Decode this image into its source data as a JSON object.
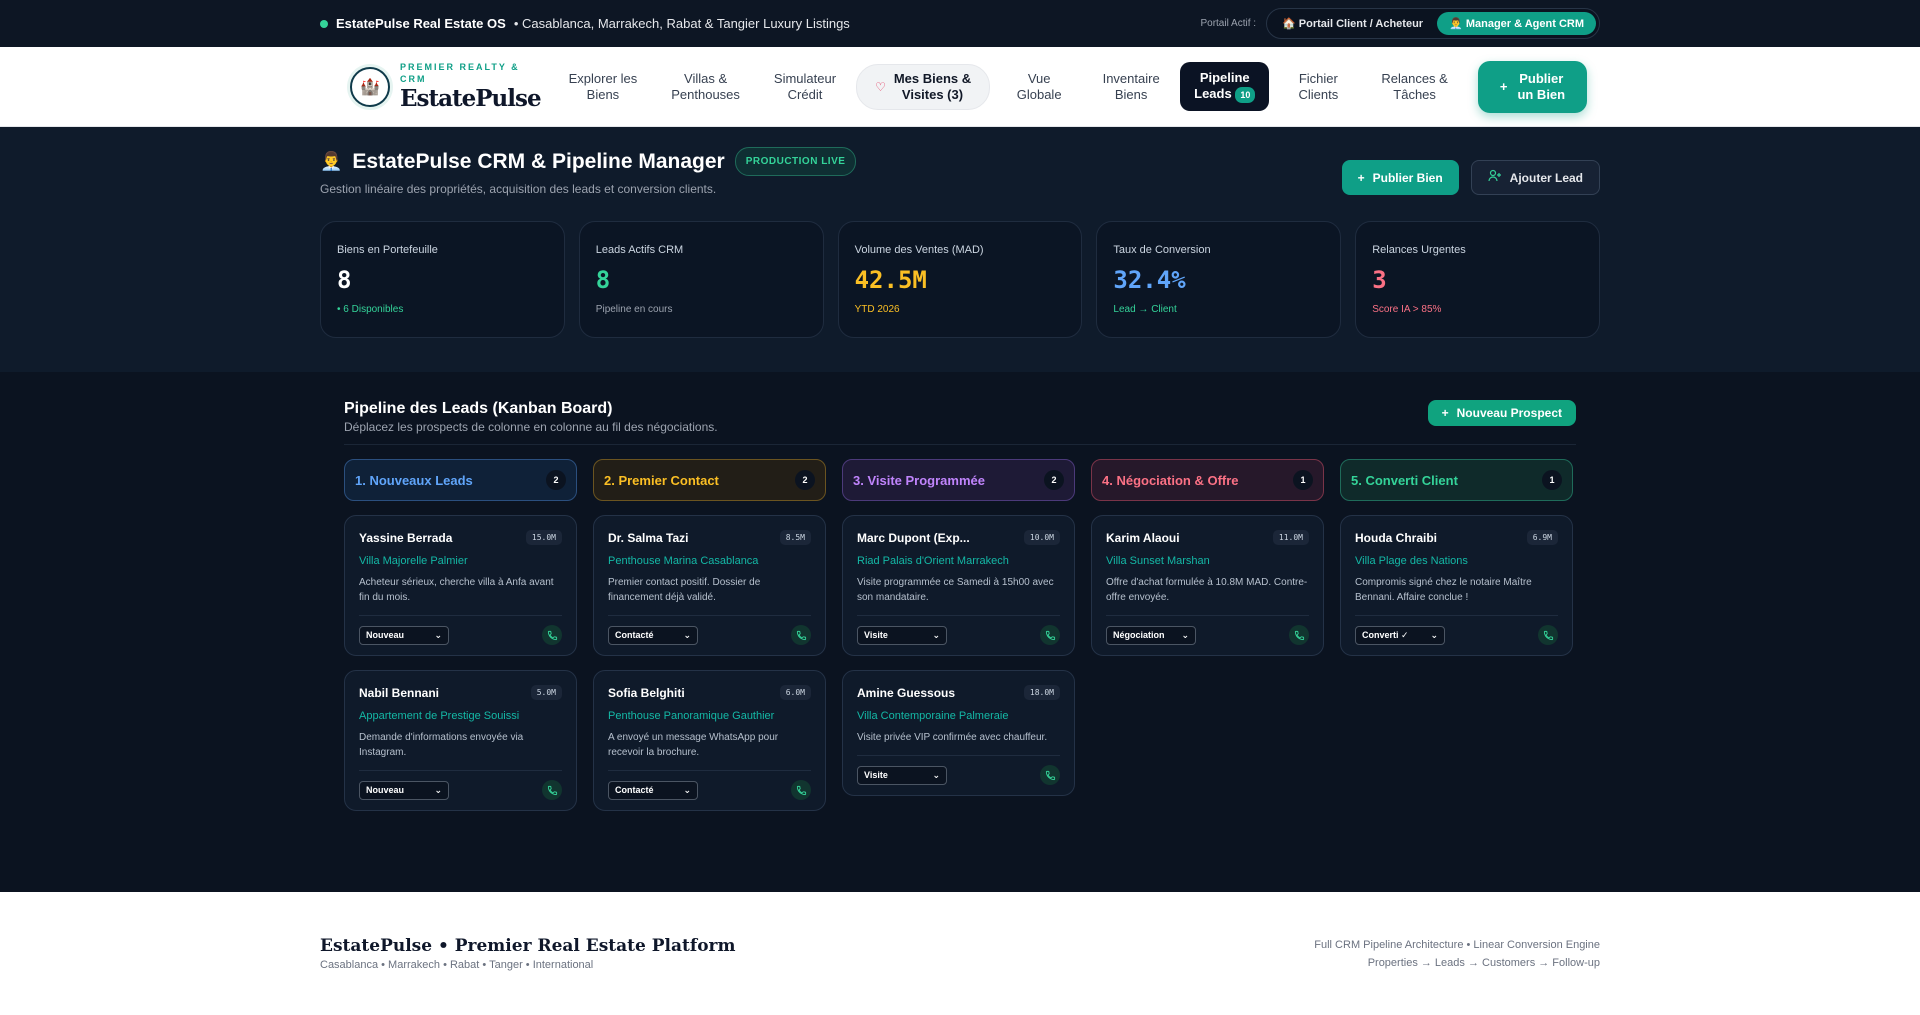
{
  "topbar": {
    "brand": "EstatePulse Real Estate OS",
    "tagline": "• Casablanca, Marrakech, Rabat & Tangier Luxury Listings",
    "portal_label": "Portail Actif :",
    "portals": [
      {
        "label": "🏠 Portail Client / Acheteur",
        "active": false
      },
      {
        "label": "👨‍💼 Manager & Agent CRM",
        "active": true
      }
    ]
  },
  "nav": {
    "brand_sub": "PREMIER REALTY & CRM",
    "brand_name": "EstatePulse",
    "brand_icon": "castle-icon",
    "items": [
      {
        "label1": "Explorer les",
        "label2": "Biens"
      },
      {
        "label1": "Villas &",
        "label2": "Penthouses"
      },
      {
        "label1": "Simulateur",
        "label2": "Crédit"
      },
      {
        "label1": "Mes Biens &",
        "label2": "Visites (3)"
      },
      {
        "label1": "Vue",
        "label2": "Globale"
      },
      {
        "label1": "Inventaire",
        "label2": "Biens"
      },
      {
        "label1": "Pipeline",
        "label2": "Leads",
        "badge": "10"
      },
      {
        "label1": "Fichier",
        "label2": "Clients"
      },
      {
        "label1": "Relances &",
        "label2": "Tâches"
      }
    ],
    "cta1": "Publier",
    "cta2": "un Bien"
  },
  "dashboard": {
    "title": "EstatePulse CRM & Pipeline Manager",
    "title_icon": "👨‍💼",
    "badge": "PRODUCTION LIVE",
    "subtitle": "Gestion linéaire des propriétés, acquisition des leads et conversion clients.",
    "btn_publish": "Publier Bien",
    "btn_lead": "Ajouter Lead",
    "kpis": [
      {
        "label": "Biens en Portefeuille",
        "value": "8",
        "sub": "• 6 Disponibles",
        "value_color": "#ffffff",
        "sub_color": "#34d399"
      },
      {
        "label": "Leads Actifs CRM",
        "value": "8",
        "sub": "Pipeline en cours",
        "value_color": "#34d399",
        "sub_color": "#9ca3af"
      },
      {
        "label": "Volume des Ventes (MAD)",
        "value": "42.5M",
        "sub": "YTD 2026",
        "value_color": "#fbbf24",
        "sub_color": "#fbbf24"
      },
      {
        "label": "Taux de Conversion",
        "value": "32.4%",
        "sub": "Lead → Client",
        "value_color": "#60a5fa",
        "sub_color": "#34d399"
      },
      {
        "label": "Relances Urgentes",
        "value": "3",
        "sub": "Score IA > 85%",
        "value_color": "#fb7185",
        "sub_color": "#fb7185"
      }
    ]
  },
  "kanban": {
    "title": "Pipeline des Leads (Kanban Board)",
    "subtitle": "Déplacez les prospects de colonne en colonne au fil des négociations.",
    "new_btn": "Nouveau Prospect",
    "columns": [
      {
        "title": "1. Nouveaux Leads",
        "count": "2",
        "color": "#60a5fa",
        "bg": "#0f2138",
        "border": "#2b4f7e",
        "cards": [
          {
            "name": "Yassine Berrada",
            "amount": "15.0M",
            "property": "Villa Majorelle Palmier",
            "note": "Acheteur sérieux, cherche villa à Anfa avant fin du mois.",
            "status": "Nouveau"
          },
          {
            "name": "Nabil Bennani",
            "amount": "5.0M",
            "property": "Appartement de Prestige Souissi",
            "note": "Demande d'informations envoyée via Instagram.",
            "status": "Nouveau"
          }
        ]
      },
      {
        "title": "2. Premier Contact",
        "count": "2",
        "color": "#fbbf24",
        "bg": "#221e17",
        "border": "#6b5420",
        "cards": [
          {
            "name": "Dr. Salma Tazi",
            "amount": "8.5M",
            "property": "Penthouse Marina Casablanca",
            "note": "Premier contact positif. Dossier de financement déjà validé.",
            "status": "Contacté"
          },
          {
            "name": "Sofia Belghiti",
            "amount": "6.0M",
            "property": "Penthouse Panoramique Gauthier",
            "note": "A envoyé un message WhatsApp pour recevoir la brochure.",
            "status": "Contacté"
          }
        ]
      },
      {
        "title": "3. Visite Programmée",
        "count": "2",
        "color": "#c084fc",
        "bg": "#1e1a36",
        "border": "#4c3a7a",
        "cards": [
          {
            "name": "Marc Dupont (Exp...",
            "amount": "10.0M",
            "property": "Riad Palais d'Orient Marrakech",
            "note": "Visite programmée ce Samedi à 15h00 avec son mandataire.",
            "status": "Visite"
          },
          {
            "name": "Amine Guessous",
            "amount": "18.0M",
            "property": "Villa Contemporaine Palmeraie",
            "note": "Visite privée VIP confirmée avec chauffeur.",
            "status": "Visite"
          }
        ]
      },
      {
        "title": "4. Négociation & Offre",
        "count": "1",
        "color": "#fb7185",
        "bg": "#26182a",
        "border": "#7a3448",
        "cards": [
          {
            "name": "Karim Alaoui",
            "amount": "11.0M",
            "property": "Villa Sunset Marshan",
            "note": "Offre d'achat formulée à 10.8M MAD. Contre-offre envoyée.",
            "status": "Négociation"
          }
        ]
      },
      {
        "title": "5. Converti Client",
        "count": "1",
        "color": "#34d399",
        "bg": "#0f2a2a",
        "border": "#1f6b5a",
        "cards": [
          {
            "name": "Houda Chraibi",
            "amount": "6.9M",
            "property": "Villa Plage des Nations",
            "note": "Compromis signé chez le notaire Maître Bennani. Affaire conclue !",
            "status": "Converti ✓"
          }
        ]
      }
    ]
  },
  "footer": {
    "title": "EstatePulse • Premier Real Estate Platform",
    "cities": "Casablanca • Marrakech • Rabat • Tanger • International",
    "right1": "Full CRM Pipeline Architecture • Linear Conversion Engine",
    "right2": "Properties → Leads → Customers → Follow-up"
  }
}
